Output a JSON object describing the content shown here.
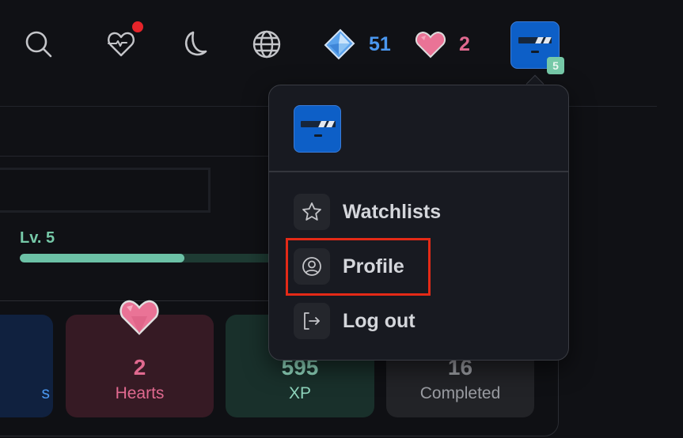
{
  "topbar": {
    "icons": [
      {
        "name": "search-icon"
      },
      {
        "name": "health-icon",
        "has_notification": true
      },
      {
        "name": "moon-icon"
      },
      {
        "name": "globe-icon"
      }
    ],
    "gems": {
      "icon": "diamond-icon",
      "count": "51",
      "color": "#4a97ef"
    },
    "hearts": {
      "icon": "heart-icon",
      "count": "2",
      "color": "#e0698f"
    },
    "avatar": {
      "level_badge": "5"
    }
  },
  "profile": {
    "level_label": "Lv. 5",
    "xp_progress_fraction": 0.63,
    "stats": [
      {
        "id": "gems",
        "value": "",
        "label": "s"
      },
      {
        "id": "hearts",
        "value": "2",
        "label": "Hearts"
      },
      {
        "id": "xp",
        "value": "595",
        "label": "XP"
      },
      {
        "id": "completed",
        "value": "16",
        "label": "Completed"
      }
    ]
  },
  "menu": {
    "items": [
      {
        "id": "watchlists",
        "label": "Watchlists",
        "icon": "star-icon"
      },
      {
        "id": "profile",
        "label": "Profile",
        "icon": "user-circle-icon",
        "highlighted": true
      },
      {
        "id": "logout",
        "label": "Log out",
        "icon": "logout-icon"
      }
    ]
  },
  "colors": {
    "accent_green": "#76c9a8",
    "avatar_blue": "#0d5fc7",
    "highlight_red": "#e42a17",
    "notification_red": "#e5242a"
  }
}
